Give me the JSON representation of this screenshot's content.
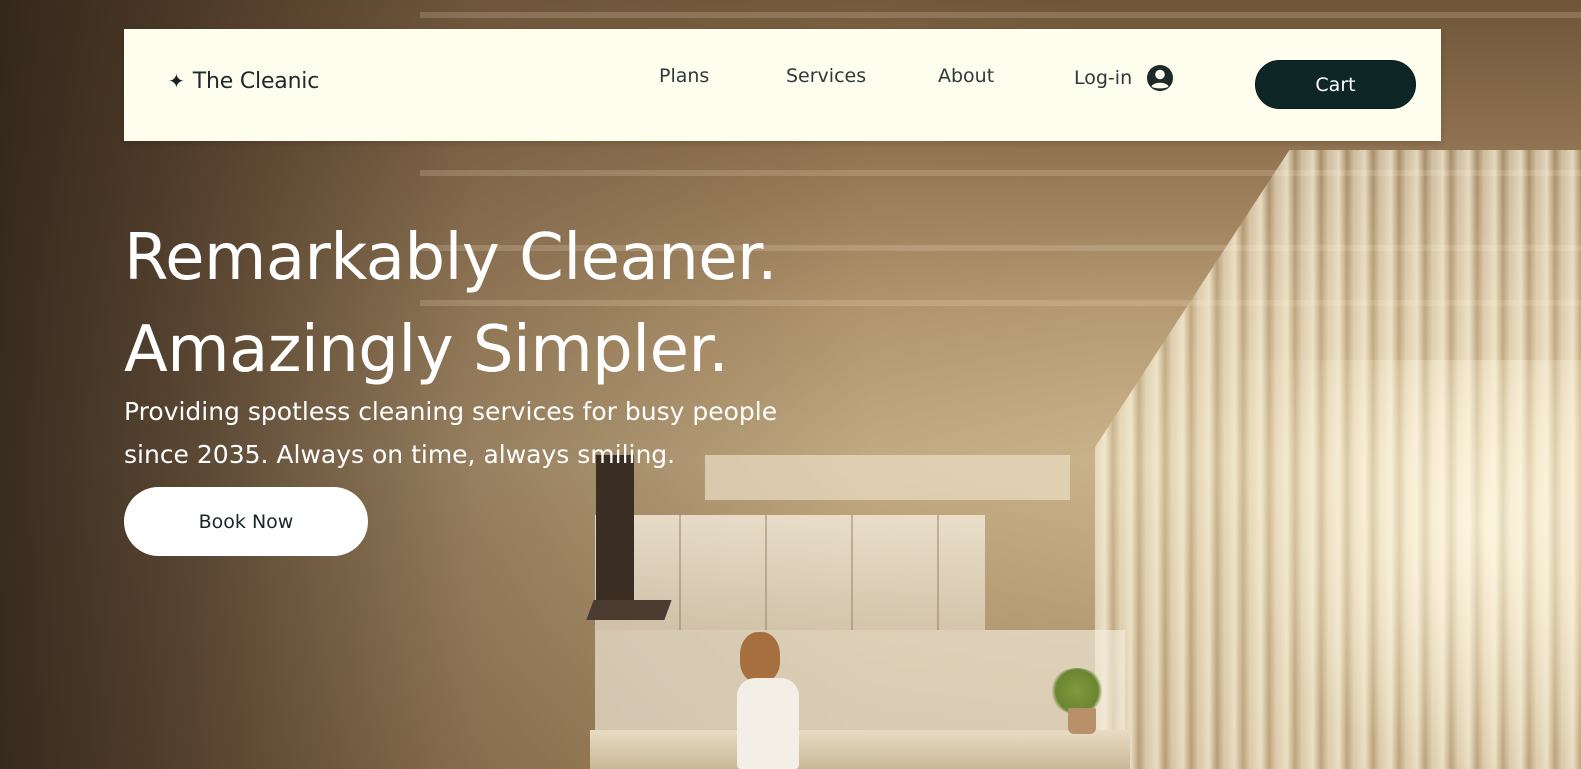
{
  "brand": {
    "logo_icon": "sparkle-icon",
    "name": "The Cleanic"
  },
  "nav": {
    "links": [
      {
        "label": "Plans"
      },
      {
        "label": "Services"
      },
      {
        "label": "About"
      }
    ],
    "login_label": "Log-in",
    "login_icon": "user-circle-icon",
    "cart_label": "Cart"
  },
  "hero": {
    "headline_line1": "Remarkably Cleaner.",
    "headline_line2": "Amazingly Simpler.",
    "subtext": "Providing spotless cleaning services for busy people since 2035. Always on time, always smiling.",
    "cta_label": "Book Now"
  },
  "colors": {
    "nav_background": "#fefeef",
    "cart_button": "#0f2627",
    "text_dark": "#2e3a3a",
    "hero_text": "#ffffff"
  }
}
